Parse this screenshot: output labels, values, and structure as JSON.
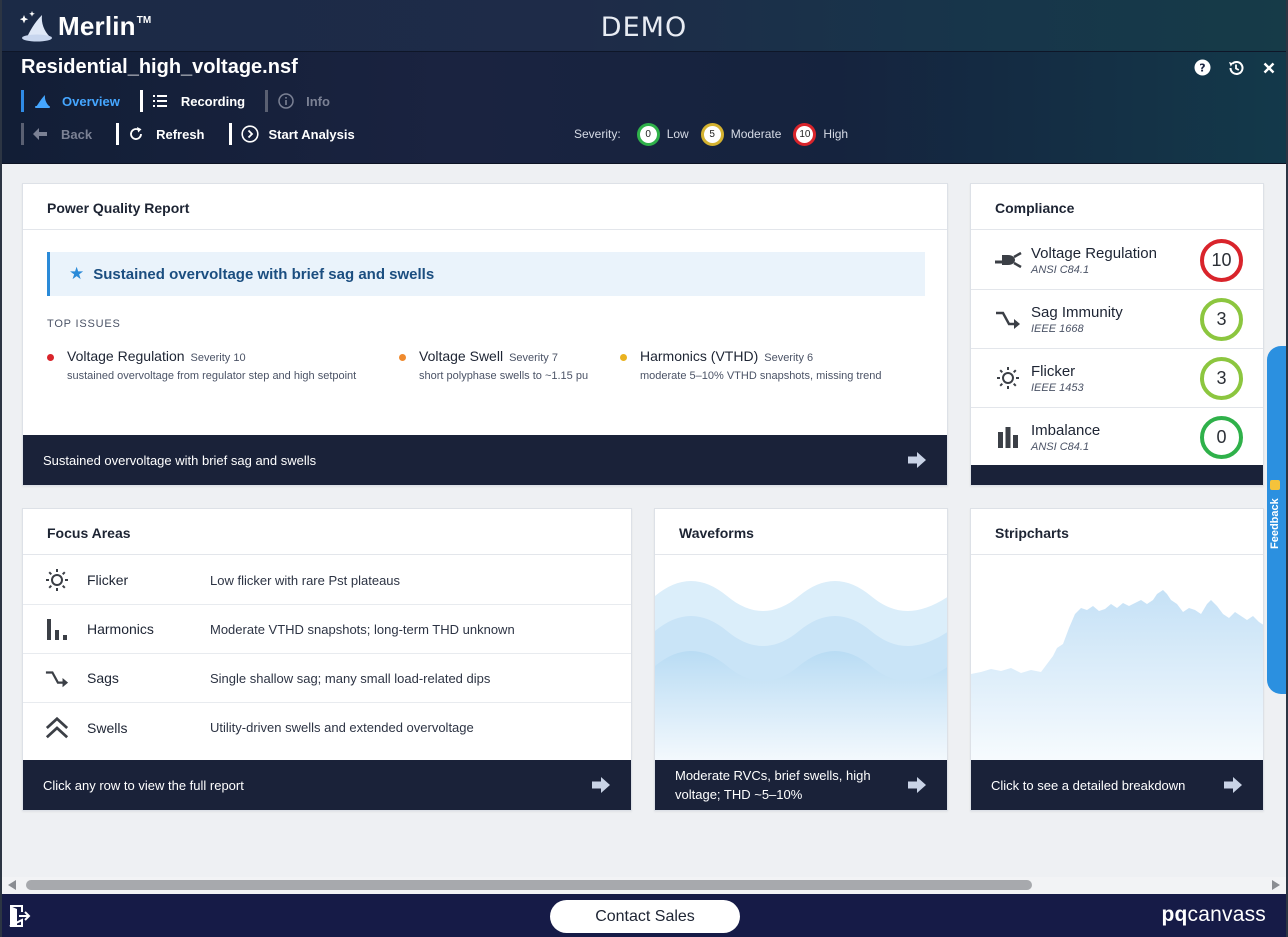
{
  "app": {
    "logo_text": "Merlin",
    "logo_tm": "TM",
    "demo_label": "DEMO",
    "file_name": "Residential_high_voltage.nsf"
  },
  "header_icons": [
    "help-icon",
    "history-icon",
    "close-icon"
  ],
  "nav": {
    "tabs": [
      {
        "label": "Overview",
        "icon": "wizard-icon",
        "state": "active"
      },
      {
        "label": "Recording",
        "icon": "list-icon",
        "state": "normal"
      },
      {
        "label": "Info",
        "icon": "info-icon",
        "state": "disabled"
      }
    ],
    "actions": [
      {
        "label": "Back",
        "icon": "back-arrow-icon",
        "state": "disabled"
      },
      {
        "label": "Refresh",
        "icon": "refresh-icon",
        "state": "normal"
      },
      {
        "label": "Start Analysis",
        "icon": "play-circle-icon",
        "state": "normal"
      }
    ]
  },
  "severity_legend": {
    "label": "Severity:",
    "levels": [
      {
        "value": "0",
        "name": "Low",
        "color": "#2fb14a"
      },
      {
        "value": "5",
        "name": "Moderate",
        "color": "#d4b230"
      },
      {
        "value": "10",
        "name": "High",
        "color": "#d9242b"
      }
    ]
  },
  "report": {
    "title": "Power Quality Report",
    "summary": "Sustained overvoltage with brief sag and swells",
    "top_issues_heading": "TOP ISSUES",
    "issues": [
      {
        "name": "Voltage Regulation",
        "severity": "Severity 10",
        "description": "sustained overvoltage from regulator step and high setpoint",
        "color": "#d9242b"
      },
      {
        "name": "Voltage Swell",
        "severity": "Severity 7",
        "description": "short polyphase swells to ~1.15 pu",
        "color": "#ef8a2e"
      },
      {
        "name": "Harmonics (VTHD)",
        "severity": "Severity 6",
        "description": "moderate 5–10% VTHD snapshots, missing trend",
        "color": "#eab21f"
      }
    ],
    "footer": "Sustained overvoltage with brief sag and swells"
  },
  "compliance": {
    "title": "Compliance",
    "items": [
      {
        "name": "Voltage Regulation",
        "standard": "ANSI C84.1",
        "score": "10",
        "color": "#d9242b",
        "icon": "plug-icon"
      },
      {
        "name": "Sag Immunity",
        "standard": "IEEE 1668",
        "score": "3",
        "color": "#8cc63f",
        "icon": "sag-icon"
      },
      {
        "name": "Flicker",
        "standard": "IEEE 1453",
        "score": "3",
        "color": "#8cc63f",
        "icon": "flicker-icon"
      },
      {
        "name": "Imbalance",
        "standard": "ANSI C84.1",
        "score": "0",
        "color": "#2fb14a",
        "icon": "bar-chart-icon"
      }
    ]
  },
  "focus": {
    "title": "Focus Areas",
    "items": [
      {
        "name": "Flicker",
        "description": "Low flicker with rare Pst plateaus",
        "icon": "flicker-icon"
      },
      {
        "name": "Harmonics",
        "description": "Moderate VTHD snapshots; long-term THD unknown",
        "icon": "harmonics-icon"
      },
      {
        "name": "Sags",
        "description": "Single shallow sag; many small load-related dips",
        "icon": "sag-icon"
      },
      {
        "name": "Swells",
        "description": "Utility-driven swells and extended overvoltage",
        "icon": "swell-icon"
      }
    ],
    "footer": "Click any row to view the full report"
  },
  "waveforms": {
    "title": "Waveforms",
    "footer": "Moderate RVCs, brief swells, high voltage; THD ~5–10%"
  },
  "stripcharts": {
    "title": "Stripcharts",
    "footer": "Click to see a detailed breakdown"
  },
  "feedback_label": "Feedback",
  "bottom": {
    "contact_label": "Contact Sales",
    "brand_pq": "pq",
    "brand_rest": "canvass"
  }
}
